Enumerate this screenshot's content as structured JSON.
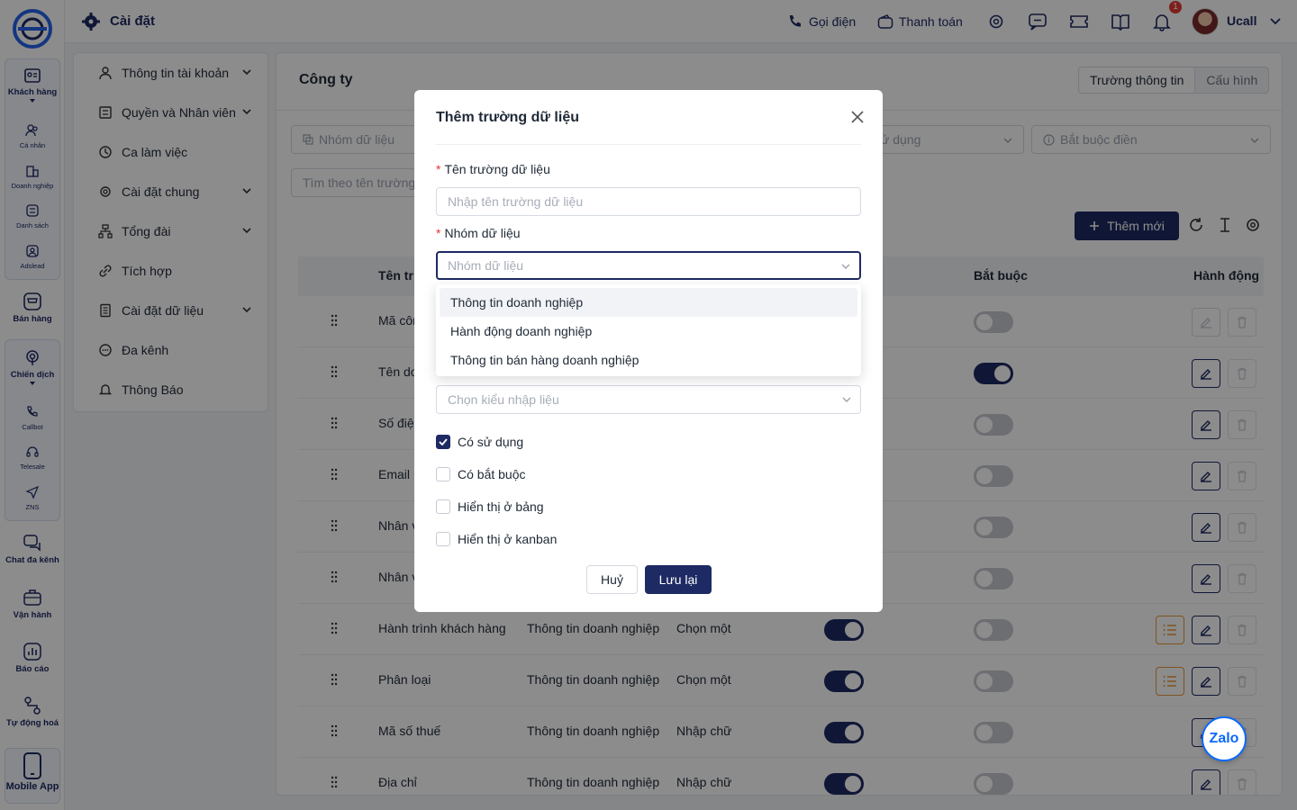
{
  "header": {
    "title": "Cài đặt",
    "call_label": "Gọi điện",
    "payment_label": "Thanh toán",
    "notification_count": "1",
    "user_name": "Ucall"
  },
  "rail": {
    "items": [
      {
        "label": "Khách hàng"
      },
      {
        "label": "Cá nhân"
      },
      {
        "label": "Doanh nghiệp"
      },
      {
        "label": "Danh sách"
      },
      {
        "label": "Adslead"
      },
      {
        "label": "Bán hàng"
      },
      {
        "label": "Chiến dịch"
      },
      {
        "label": "Callbot"
      },
      {
        "label": "Telesale"
      },
      {
        "label": "ZNS"
      },
      {
        "label": "Chat đa kênh"
      },
      {
        "label": "Vận hành"
      },
      {
        "label": "Báo cáo"
      },
      {
        "label": "Tự động hoá"
      },
      {
        "label": "Mobile App"
      }
    ]
  },
  "menu": {
    "items": [
      {
        "label": "Thông tin tài khoản"
      },
      {
        "label": "Quyền và Nhân viên"
      },
      {
        "label": "Ca làm việc"
      },
      {
        "label": "Cài đặt chung"
      },
      {
        "label": "Tổng đài"
      },
      {
        "label": "Tích hợp"
      },
      {
        "label": "Cài đặt dữ liệu"
      },
      {
        "label": "Đa kênh"
      },
      {
        "label": "Thông Báo"
      }
    ]
  },
  "panel": {
    "title": "Công ty",
    "seg_fields": "Trường thông tin",
    "seg_config": "Cấu hình",
    "filter_group": "Nhóm dữ liệu",
    "filter_used": "ử dụng",
    "filter_required": "Bắt buộc điền",
    "search_placeholder": "Tìm theo tên trường",
    "new_button": "Thêm mới",
    "col_name": "Tên tr",
    "col_required": "Bắt buộc",
    "col_action": "Hành động",
    "rows": [
      {
        "name": "Mã côn",
        "group": "",
        "type": ""
      },
      {
        "name": "Tên do",
        "group": "",
        "type": ""
      },
      {
        "name": "Số điện",
        "group": "",
        "type": ""
      },
      {
        "name": "Email",
        "group": "",
        "type": ""
      },
      {
        "name": "Nhân v",
        "group": "",
        "type": ""
      },
      {
        "name": "Nhân v",
        "group": "",
        "type": ""
      },
      {
        "name": "Hành trình khách hàng",
        "group": "Thông tin doanh nghiệp",
        "type": "Chọn một"
      },
      {
        "name": "Phân loại",
        "group": "Thông tin doanh nghiệp",
        "type": "Chọn một"
      },
      {
        "name": "Mã số thuế",
        "group": "Thông tin doanh nghiệp",
        "type": "Nhập chữ"
      },
      {
        "name": "Địa chỉ",
        "group": "Thông tin doanh nghiệp",
        "type": "Nhập chữ"
      }
    ]
  },
  "modal": {
    "title": "Thêm trường dữ liệu",
    "field_name_label": "Tên trường dữ liệu",
    "field_name_placeholder": "Nhập tên trường dữ liệu",
    "group_label": "Nhóm dữ liệu",
    "group_placeholder": "Nhóm dữ liệu",
    "group_options": [
      "Thông tin doanh nghiệp",
      "Hành động doanh nghiệp",
      "Thông tin bán hàng doanh nghiệp"
    ],
    "input_type_placeholder": "Chọn kiểu nhập liệu",
    "checks": [
      {
        "label": "Có sử dụng",
        "checked": true
      },
      {
        "label": "Có bắt buộc",
        "checked": false
      },
      {
        "label": "Hiển thị ở bảng",
        "checked": false
      },
      {
        "label": "Hiển thị ở kanban",
        "checked": false
      }
    ],
    "cancel_label": "Huỷ",
    "save_label": "Lưu lại"
  },
  "zalo_label": "Zalo",
  "colors": {
    "brand": "#1e2a63",
    "accent_orange": "#e59a3b",
    "danger": "#e53935"
  }
}
